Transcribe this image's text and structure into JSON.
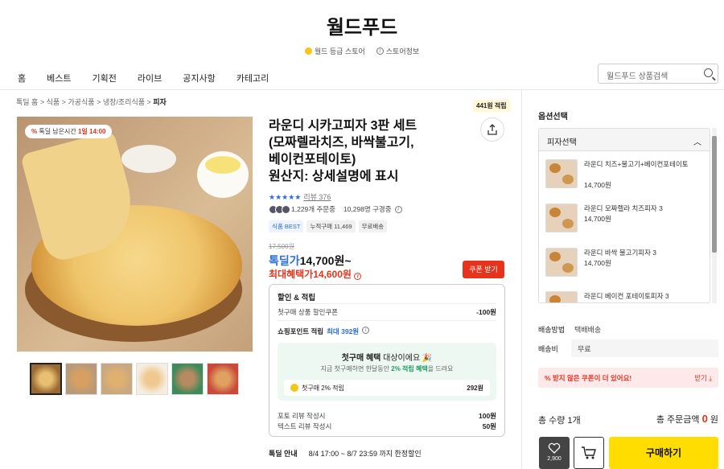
{
  "store": {
    "name": "월드푸드",
    "grade": "월드 등급 스토어",
    "info": "스토어정보"
  },
  "nav": {
    "items": [
      "홈",
      "베스트",
      "기획전",
      "라이브",
      "공지사항",
      "카테고리"
    ],
    "search_placeholder": "월드푸드 상품검색"
  },
  "breadcrumb": {
    "items": [
      "톡딜 홈",
      "식품",
      "가공식품",
      "냉장/조리식품"
    ],
    "current": "피자"
  },
  "points_badge": "441원 적립",
  "image": {
    "timer_prefix": "톡딜 남은시간",
    "timer_value": "1일 14:00"
  },
  "product": {
    "title_line1": "라운디 시카고피자 3판 세트",
    "title_line2": "(모짜렐라치즈, 바싹불고기,",
    "title_line3": "베이컨포테이토)",
    "title_line4": "원산지: 상세설명에 표시",
    "stars": "★★★★★",
    "review_label": "리뷰 376",
    "orders": "1,229개 주문중",
    "subscribers": "10,298명 구경중",
    "tags": [
      "식품 BEST",
      "누적구매 11,469",
      "무료배송"
    ],
    "original_price": "17,500원",
    "talk_label": "톡딜가",
    "talk_price": "14,700원~",
    "max_label": "최대혜택가",
    "max_price": "14,600원",
    "coupon_button": "쿠폰 받기"
  },
  "benefits": {
    "title": "할인 & 적립",
    "first_coupon_label": "첫구매 상품 할인쿠폰",
    "first_coupon_value": "-100원",
    "shopping_points_label": "쇼핑포인트 적립",
    "shopping_points_max": "최대 392원",
    "green_title_bold": "첫구매 혜택",
    "green_title_rest": "대상이에요",
    "green_sub_pre": "지금 첫구매하면 한달동안",
    "green_sub_bold": "2% 적립 혜택",
    "green_sub_post": "을 드려요",
    "green_row_label": "첫구매 2% 적립",
    "green_row_value": "292원",
    "photo_review_label": "포토 리뷰 작성시",
    "photo_review_value": "100원",
    "text_review_label": "텍스트 리뷰 작성시",
    "text_review_value": "50원"
  },
  "event": {
    "label": "톡딜 안내",
    "text": "8/4 17:00 ~ 8/7 23:59 까지 한정할인"
  },
  "options": {
    "title": "옵션선택",
    "group": "피자선택",
    "items": [
      {
        "name": "라운디 치즈+불고기+베이컨포테이토",
        "price": "14,700원"
      },
      {
        "name": "라운디 모짜렐라 치즈피자 3",
        "price": "14,700원"
      },
      {
        "name": "라운디 바싹 불고기피자 3",
        "price": "14,700원"
      },
      {
        "name": "라운디 베이컨 포테이토피자 3",
        "price": ""
      }
    ]
  },
  "shipping": {
    "method_label": "배송방법",
    "method_value": "택배배송",
    "fee_label": "배송비",
    "fee_value": "무료"
  },
  "coupon_banner": {
    "text": "받지 않은 쿠폰이 더 있어요!",
    "action": "받기"
  },
  "summary": {
    "qty_label": "총 수량",
    "qty_value": "1개",
    "total_label": "총 주문금액",
    "total_value": "0",
    "total_unit": "원"
  },
  "actions": {
    "wish_count": "2,900",
    "buy_label": "구매하기"
  },
  "colors": {
    "accent_red": "#e8331c",
    "accent_blue": "#2a6edb",
    "buy_yellow": "#ffdd00"
  }
}
